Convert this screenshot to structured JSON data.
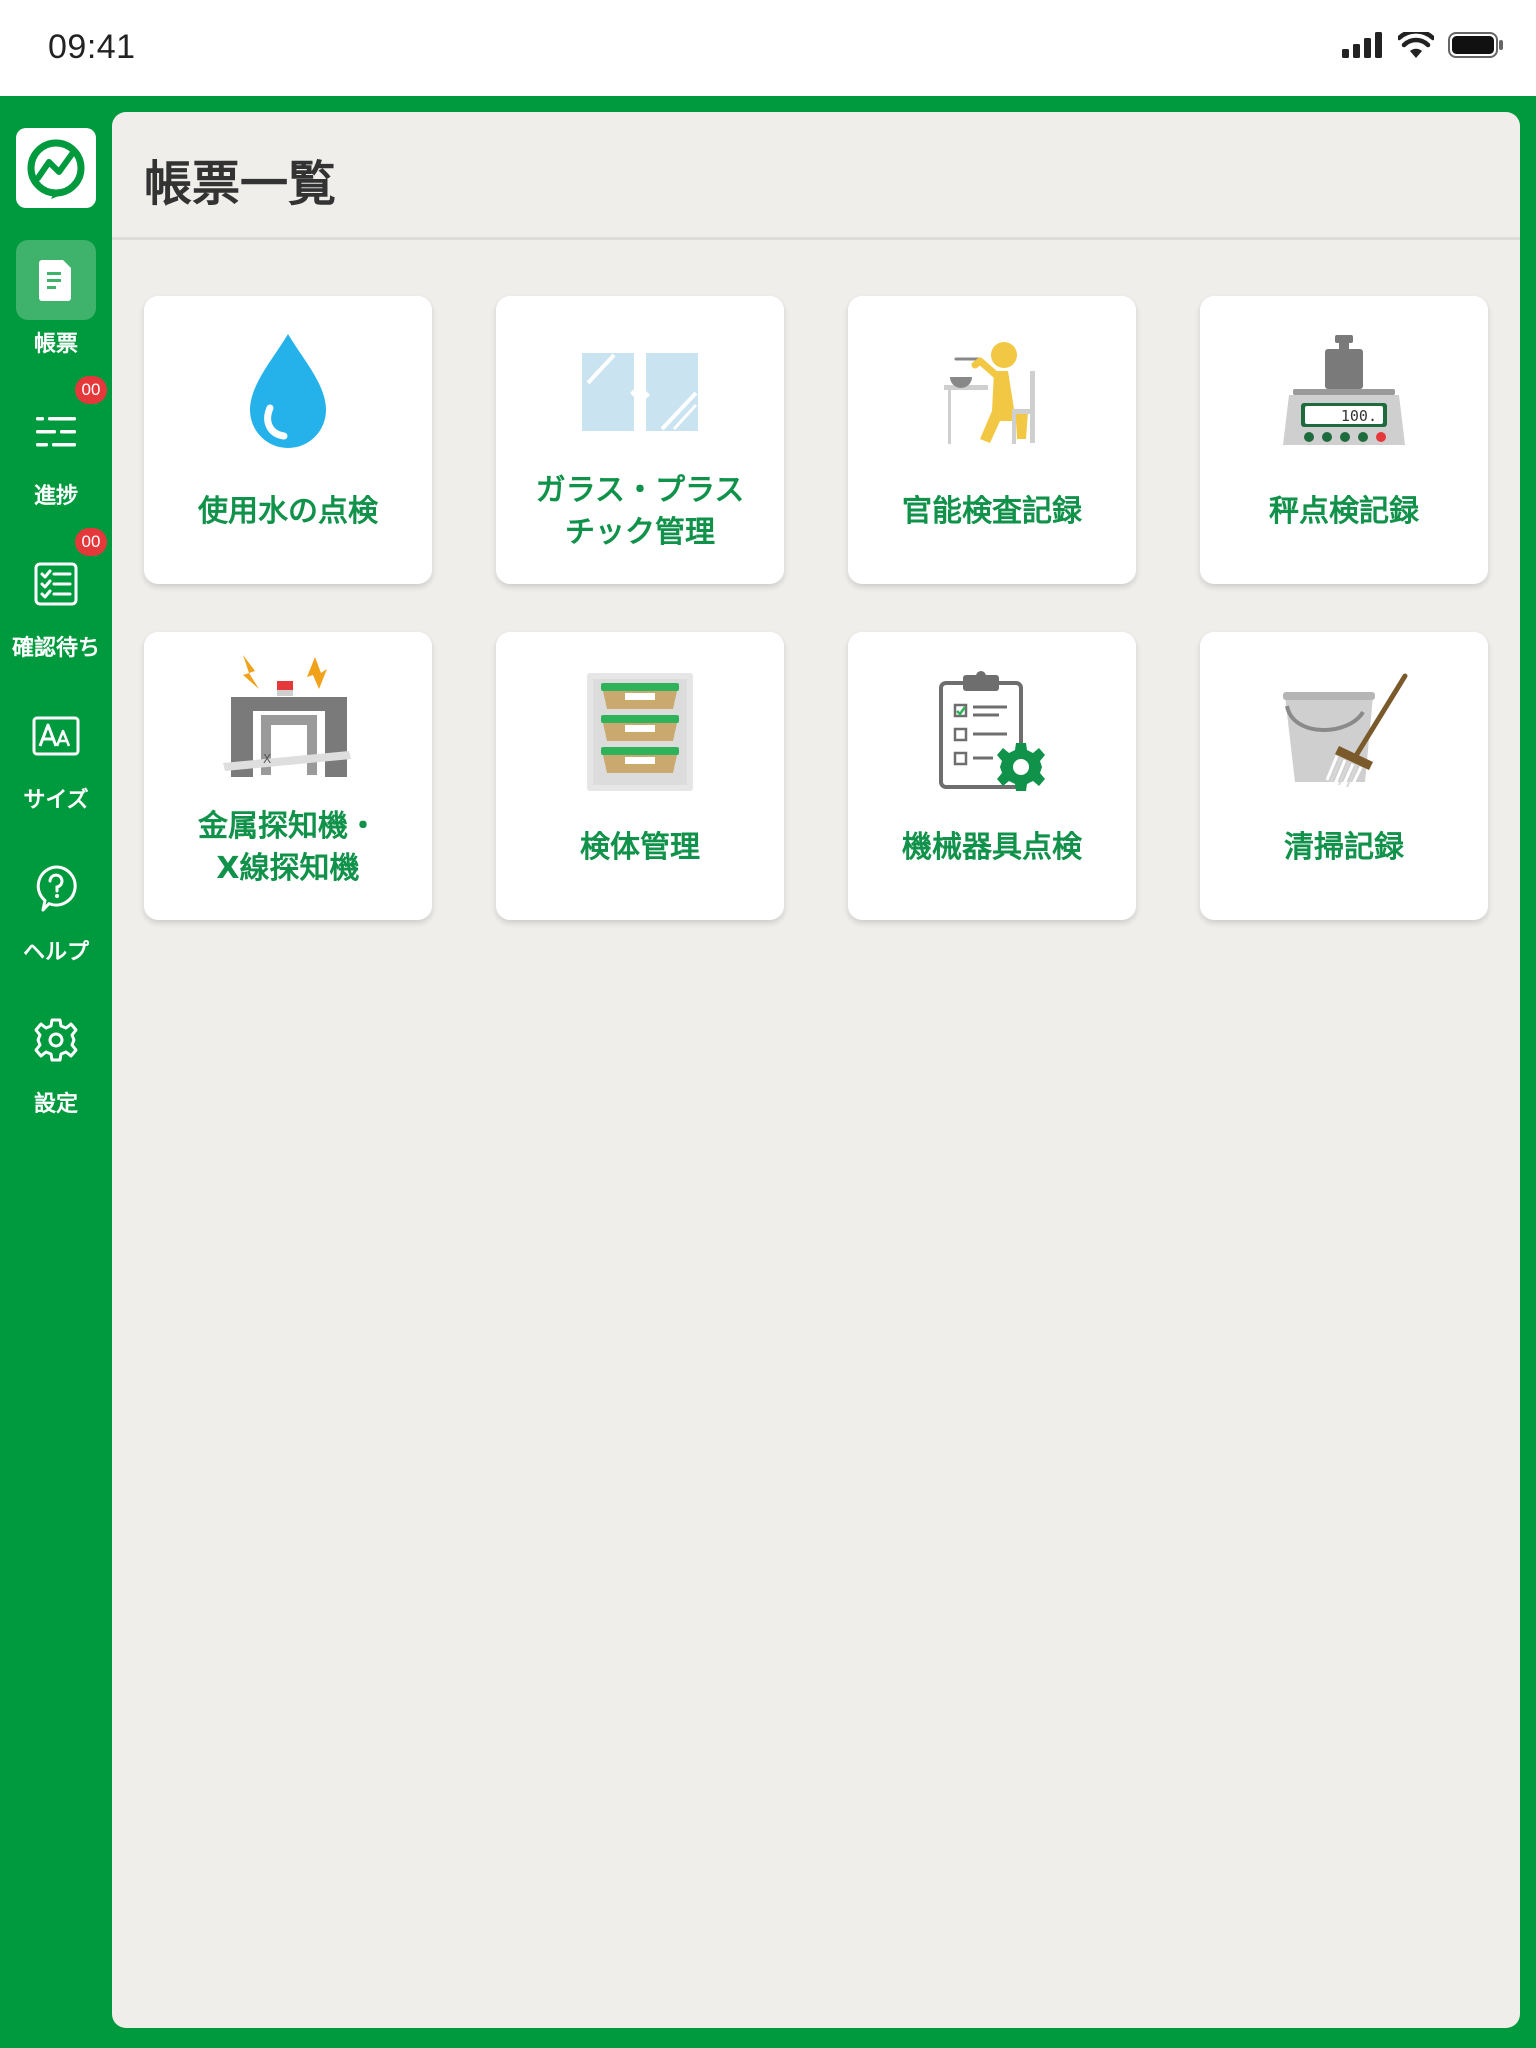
{
  "status_bar": {
    "time": "09:41"
  },
  "page": {
    "title": "帳票一覧"
  },
  "sidebar": {
    "items": [
      {
        "label": "帳票"
      },
      {
        "label": "進捗",
        "badge": "00"
      },
      {
        "label": "確認待ち",
        "badge": "00"
      },
      {
        "label": "サイズ"
      },
      {
        "label": "ヘルプ"
      },
      {
        "label": "設定"
      }
    ]
  },
  "forms": [
    {
      "label": "使用水の点検",
      "icon": "water-drop-icon"
    },
    {
      "label": "ガラス・プラス\nチック管理",
      "icon": "glass-pane-icon"
    },
    {
      "label": "官能検査記録",
      "icon": "sensory-tasting-icon"
    },
    {
      "label": "秤点検記録",
      "icon": "weighing-scale-icon"
    },
    {
      "label": "金属探知機・\nX線探知機",
      "icon": "metal-detector-icon"
    },
    {
      "label": "検体管理",
      "icon": "sample-containers-icon"
    },
    {
      "label": "機械器具点検",
      "icon": "equipment-checklist-icon"
    },
    {
      "label": "清掃記録",
      "icon": "cleaning-bucket-icon"
    }
  ],
  "colors": {
    "brand_green": "#009a3e",
    "label_green": "#11924a",
    "badge_red": "#e5383b",
    "panel_bg": "#efeeeb"
  }
}
